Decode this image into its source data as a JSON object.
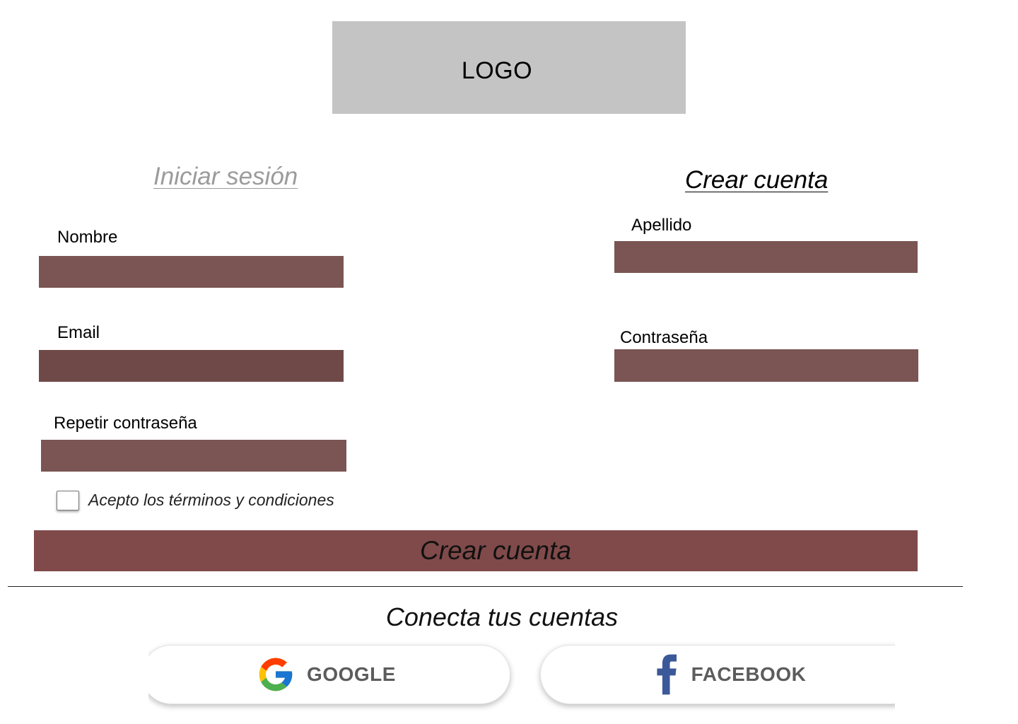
{
  "logo": {
    "text": "LOGO"
  },
  "tabs": {
    "login": "Iniciar sesión",
    "create": "Crear cuenta"
  },
  "form": {
    "nombre_label": "Nombre",
    "email_label": "Email",
    "repeat_password_label": "Repetir contraseña",
    "apellido_label": "Apellido",
    "password_label": "Contraseña",
    "terms_label": "Acepto los términos y condiciones",
    "submit_label": "Crear cuenta"
  },
  "social": {
    "title": "Conecta tus cuentas",
    "google_label": "GOOGLE",
    "facebook_label": "FACEBOOK"
  },
  "colors": {
    "field": "#7a5553",
    "field_dark": "#6f4948",
    "submit": "#804a4a",
    "logo_bg": "#c4c4c4",
    "google_blue": "#4285F4",
    "google_red": "#EA4335",
    "google_yellow": "#FBBC05",
    "google_green": "#34A853",
    "facebook_blue": "#3b5998"
  }
}
